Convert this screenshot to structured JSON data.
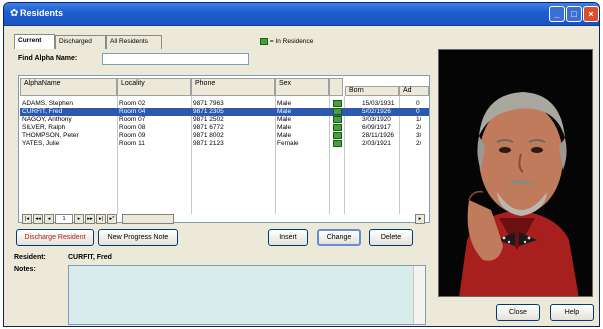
{
  "window": {
    "title": "Residents",
    "minimize": "_",
    "maximize": "□",
    "close": "×"
  },
  "tabs": [
    {
      "label": "Current"
    },
    {
      "label": "Discharged"
    },
    {
      "label": "All Residents"
    }
  ],
  "legend": {
    "label": "= In Residence",
    "color": "#46a03c"
  },
  "find": {
    "label": "Find Alpha Name:",
    "value": ""
  },
  "grid": {
    "columns": [
      "AlphaName",
      "Locality",
      "Phone",
      "Sex",
      "Born",
      "Ad"
    ],
    "rows": [
      {
        "name": "ADAMS, Stephen",
        "locality": "Room 02",
        "phone": "9871 7963",
        "sex": "Male",
        "born": "15/03/1931",
        "ad": "0"
      },
      {
        "name": "CURFIT, Fred",
        "locality": "Room 04",
        "phone": "9871 2305",
        "sex": "Male",
        "born": "5/02/1926",
        "ad": "0"
      },
      {
        "name": "NAGOY, Anthony",
        "locality": "Room 07",
        "phone": "9871 2502",
        "sex": "Male",
        "born": "3/03/1920",
        "ad": "1/"
      },
      {
        "name": "SILVER, Ralph",
        "locality": "Room 08",
        "phone": "9871 6772",
        "sex": "Male",
        "born": "6/09/1917",
        "ad": "2/"
      },
      {
        "name": "THOMPSON, Peter",
        "locality": "Room 09",
        "phone": "9871 8002",
        "sex": "Male",
        "born": "28/11/1926",
        "ad": "3/"
      },
      {
        "name": "YATES, Julie",
        "locality": "Room 11",
        "phone": "9871 2123",
        "sex": "Female",
        "born": "2/03/1921",
        "ad": "2/"
      }
    ],
    "selected_index": 1
  },
  "navigator": {
    "first": "|◂",
    "prev_page": "◂◂",
    "prev": "◂",
    "record": "1",
    "next": "▸",
    "next_page": "▸▸",
    "last": "▸|",
    "new": "▸*",
    "scroll_right": "▸"
  },
  "buttons": {
    "discharge": "Discharge Resident",
    "progress_note": "New Progress Note",
    "insert": "Insert",
    "change": "Change",
    "delete": "Delete",
    "close": "Close",
    "help": "Help"
  },
  "detail": {
    "resident_label": "Resident:",
    "resident_value": "CURFIT, Fred",
    "notes_label": "Notes:",
    "notes_value": ""
  }
}
